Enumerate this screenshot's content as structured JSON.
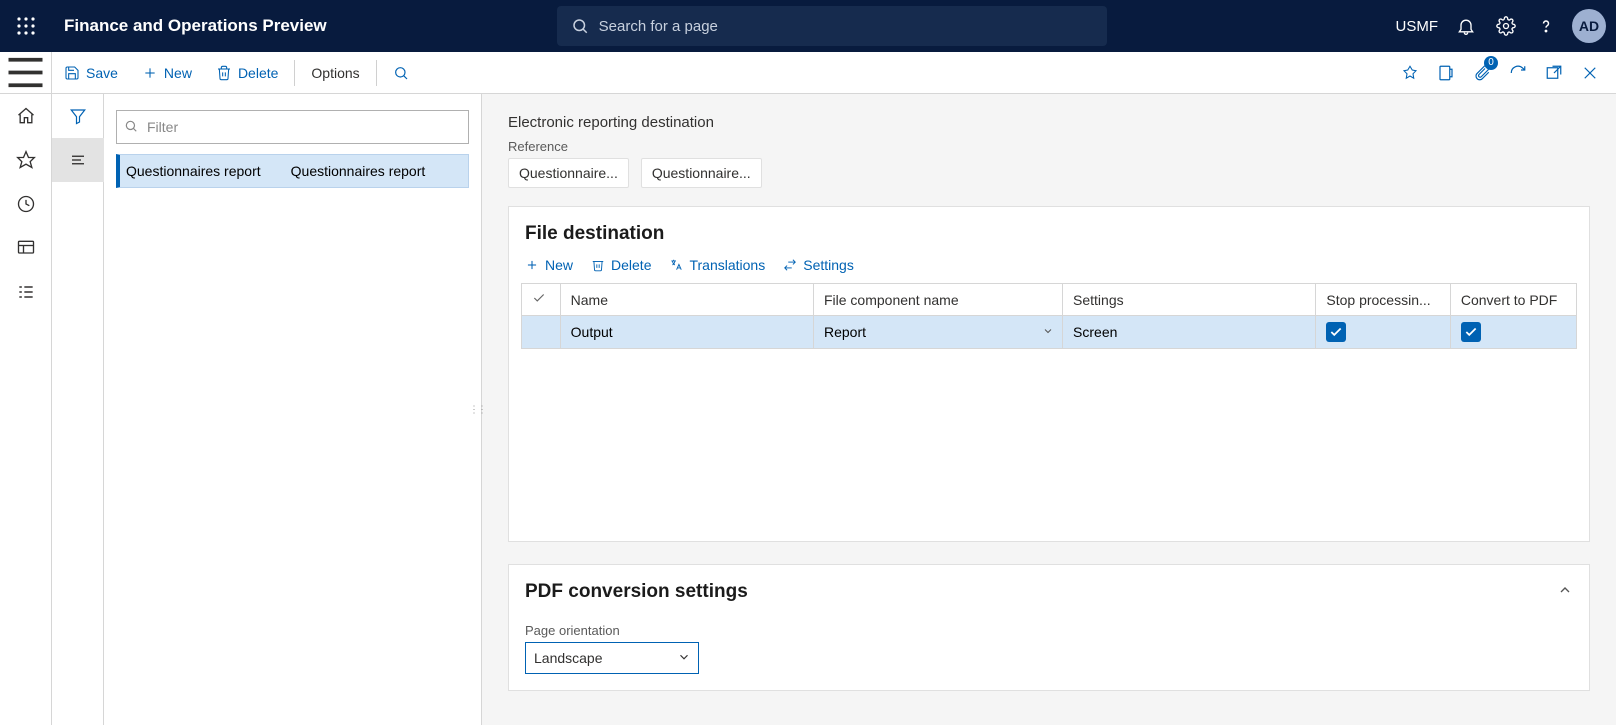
{
  "header": {
    "app_title": "Finance and Operations Preview",
    "search_placeholder": "Search for a page",
    "entity": "USMF",
    "avatar_initials": "AD",
    "attachment_badge": "0"
  },
  "actionbar": {
    "save_label": "Save",
    "new_label": "New",
    "delete_label": "Delete",
    "options_label": "Options"
  },
  "listpane": {
    "filter_placeholder": "Filter",
    "item1_col1": "Questionnaires report",
    "item1_col2": "Questionnaires report"
  },
  "main": {
    "page_title": "Electronic reporting destination",
    "reference_label": "Reference",
    "reference_values": [
      "Questionnaire...",
      "Questionnaire..."
    ]
  },
  "file_destination": {
    "title": "File destination",
    "toolbar": {
      "new": "New",
      "delete": "Delete",
      "translations": "Translations",
      "settings": "Settings"
    },
    "columns": {
      "name": "Name",
      "file_component": "File component name",
      "settings": "Settings",
      "stop": "Stop processin...",
      "pdf": "Convert to PDF"
    },
    "rows": [
      {
        "name": "Output",
        "file_component": "Report",
        "settings": "Screen",
        "stop": true,
        "pdf": true
      }
    ]
  },
  "pdf_settings": {
    "title": "PDF conversion settings",
    "page_orientation_label": "Page orientation",
    "page_orientation_value": "Landscape"
  }
}
